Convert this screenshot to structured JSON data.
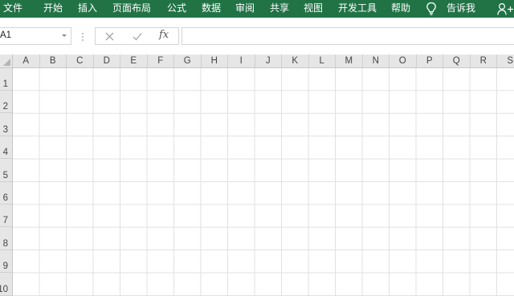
{
  "ribbon": {
    "tabs": [
      "文件",
      "开始",
      "插入",
      "页面布局",
      "公式",
      "数据",
      "审阅",
      "共享",
      "视图",
      "开发工具",
      "帮助"
    ],
    "tell_me": "告诉我",
    "lightbulb_icon": "lightbulb-icon",
    "share_icon": "person-share-icon",
    "accent": "#217346"
  },
  "formula_bar": {
    "name_box_value": "A1",
    "cancel_icon": "close-icon",
    "enter_icon": "check-icon",
    "fx_label": "fx",
    "formula_value": ""
  },
  "sheet": {
    "columns": [
      "A",
      "B",
      "C",
      "D",
      "E",
      "F",
      "G",
      "H",
      "I",
      "J",
      "K",
      "L",
      "M",
      "N",
      "O",
      "P",
      "Q",
      "R",
      "S"
    ],
    "rows": [
      "1",
      "2",
      "3",
      "4",
      "5",
      "6",
      "7",
      "8",
      "9",
      "10"
    ]
  }
}
